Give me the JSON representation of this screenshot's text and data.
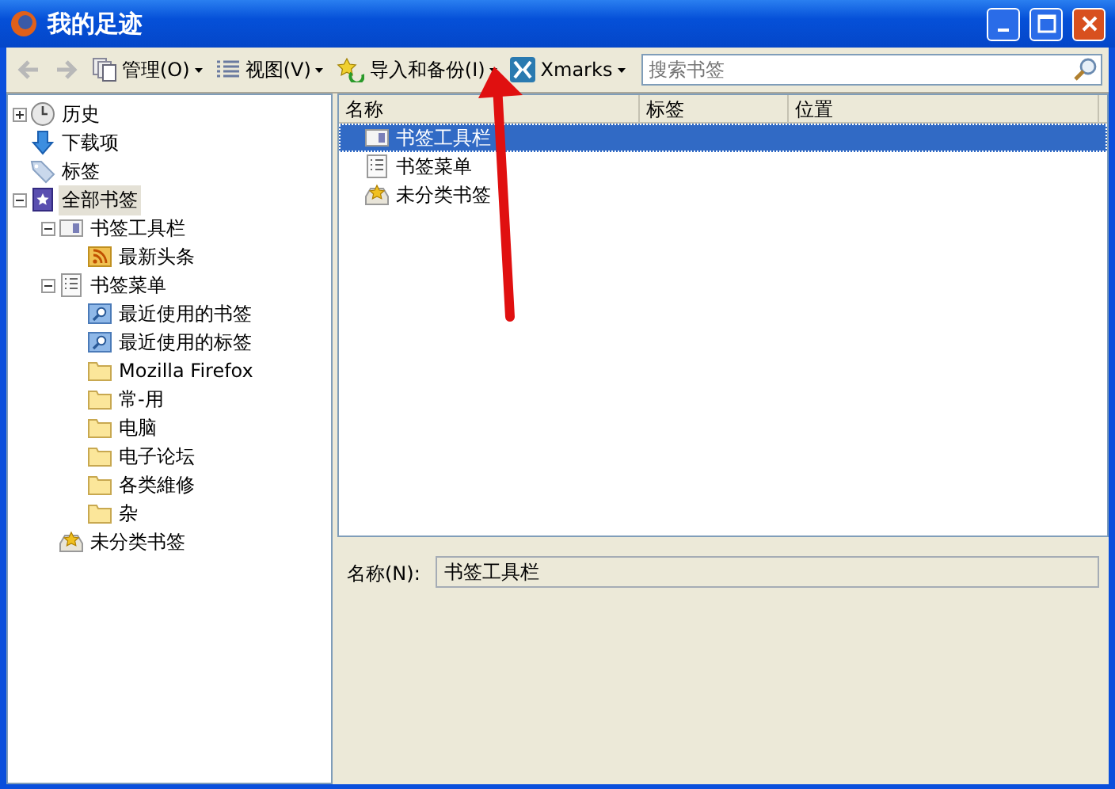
{
  "window": {
    "title": "我的足迹"
  },
  "toolbar": {
    "buttons": [
      {
        "kind": "back",
        "disabled": true
      },
      {
        "kind": "forward",
        "disabled": true
      }
    ],
    "menus": [
      {
        "kind": "organize",
        "label": "管理(O)"
      },
      {
        "kind": "views",
        "label": "视图(V)"
      },
      {
        "kind": "import",
        "label": "导入和备份(I)"
      },
      {
        "kind": "xmarks",
        "label": "Xmarks"
      }
    ],
    "search": {
      "placeholder": "搜索书签"
    }
  },
  "sidebar": {
    "items": [
      {
        "label": "历史",
        "kind": "clock",
        "expanded": false,
        "selected": false
      },
      {
        "label": "下载项",
        "kind": "download",
        "selected": false
      },
      {
        "label": "标签",
        "kind": "tag",
        "selected": false
      },
      {
        "label": "全部书签",
        "kind": "library",
        "expanded": true,
        "selected": true,
        "children": [
          {
            "label": "书签工具栏",
            "kind": "toolbar",
            "expanded": true,
            "selected": false,
            "children": [
              {
                "label": "最新头条",
                "kind": "feed",
                "selected": false
              }
            ]
          },
          {
            "label": "书签菜单",
            "kind": "menu",
            "expanded": true,
            "selected": false,
            "children": [
              {
                "label": "最近使用的书签",
                "kind": "query",
                "selected": false
              },
              {
                "label": "最近使用的标签",
                "kind": "query",
                "selected": false
              },
              {
                "label": "Mozilla Firefox",
                "kind": "folder",
                "selected": false
              },
              {
                "label": "常-用",
                "kind": "folder",
                "selected": false
              },
              {
                "label": "电脑",
                "kind": "folder",
                "selected": false
              },
              {
                "label": "电子论坛",
                "kind": "folder",
                "selected": false
              },
              {
                "label": "各类維修",
                "kind": "folder",
                "selected": false
              },
              {
                "label": "杂",
                "kind": "folder",
                "selected": false
              }
            ]
          },
          {
            "label": "未分类书签",
            "kind": "unsorted",
            "selected": false
          }
        ]
      }
    ]
  },
  "table": {
    "columns": [
      "名称",
      "标签",
      "位置"
    ],
    "rows": [
      {
        "name": "书签工具栏",
        "kind": "toolbar",
        "selected": true
      },
      {
        "name": "书签菜单",
        "kind": "menu",
        "selected": false
      },
      {
        "name": "未分类书签",
        "kind": "unsorted",
        "selected": false
      }
    ]
  },
  "details": {
    "label": "名称(N):",
    "value": "书签工具栏"
  }
}
